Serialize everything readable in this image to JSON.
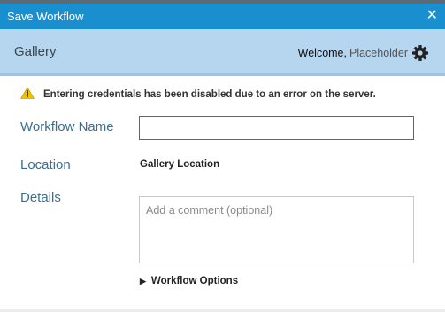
{
  "window": {
    "title": "Save Workflow",
    "close_label": "✕"
  },
  "header": {
    "gallery_label": "Gallery",
    "welcome_prefix": "Welcome,",
    "welcome_user": "Placeholder",
    "settings_icon": "gear-icon"
  },
  "warning": {
    "icon": "warning-icon",
    "text": "Entering credentials has been disabled due to an error on the server."
  },
  "form": {
    "workflow_name_label": "Workflow Name",
    "workflow_name_value": "",
    "location_label": "Location",
    "location_value": "Gallery Location",
    "details_label": "Details",
    "details_placeholder": "Add a comment (optional)",
    "workflow_options_label": "Workflow Options"
  },
  "colors": {
    "titlebar": "#1a8fd0",
    "header": "#b6d5ef",
    "label_text": "#3a6f93",
    "input_border": "#1976c8"
  }
}
